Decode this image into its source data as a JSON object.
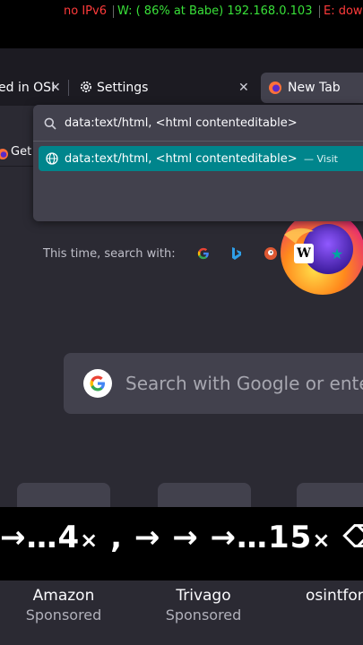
{
  "status_bar": {
    "ipv6": "no IPv6",
    "wireless": "W: ( 86% at Babe) 192.168.0.103",
    "ethernet": "E: dow",
    "colors": {
      "ipv6": "#ff3b3b",
      "wireless": "#39e039",
      "ethernet": "#ff3b3b"
    }
  },
  "tabs": [
    {
      "label": "ed in OSI",
      "icon": "close-icon"
    },
    {
      "label": "Settings",
      "icon": "gear-icon"
    },
    {
      "label": "New Tab",
      "icon": "firefox-icon",
      "active": true
    }
  ],
  "url_panel": {
    "typed_text": "data:text/html, <html contenteditable>",
    "result_text": "data:text/html, <html contenteditable>",
    "result_action": "— Visit",
    "search_with_label": "This time, search with:",
    "engines": [
      "google",
      "bing",
      "duckduckgo",
      "wikipedia",
      "bookmark-star"
    ]
  },
  "bookmarks": {
    "item_label": "Get"
  },
  "new_tab": {
    "search_placeholder": "Search with Google or ente"
  },
  "key_overlay": {
    "keys_part1": "→…",
    "count1": "4",
    "mult1": "×",
    "keys_part2": " , → → →…",
    "count2": "15",
    "mult2": "×",
    "keys_part3": " ⌫"
  },
  "top_sites": [
    {
      "name": "Amazon",
      "sponsored": "Sponsored"
    },
    {
      "name": "Trivago",
      "sponsored": "Sponsored"
    },
    {
      "name": "osintfor",
      "sponsored": ""
    }
  ],
  "accent_color": "#00858c"
}
